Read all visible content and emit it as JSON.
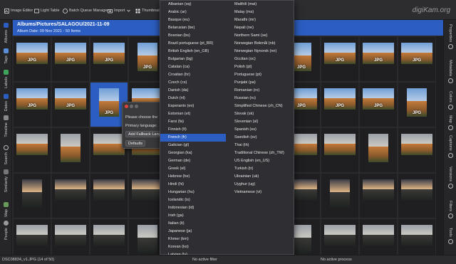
{
  "toolbar": {
    "items": [
      {
        "label": "Image Editor",
        "icon": "image-editor-icon"
      },
      {
        "label": "Light Table",
        "icon": "light-table-icon"
      },
      {
        "label": "Batch Queue Manager",
        "icon": "batch-queue-icon"
      },
      {
        "label": "Import",
        "icon": "import-icon"
      },
      {
        "label": "Thumbnails",
        "icon": "thumbnails-icon"
      }
    ],
    "brand": "digiKam.org"
  },
  "left_sidebar": {
    "tabs": [
      "Albums",
      "Tags",
      "Labels",
      "Dates",
      "Timeline",
      "Search",
      "Similarity",
      "Map",
      "People"
    ]
  },
  "right_sidebar": {
    "tabs": [
      "Properties",
      "Metadata",
      "Colors",
      "Map",
      "Captions",
      "Versions",
      "Filters",
      "Tools"
    ]
  },
  "header": {
    "title": "Albums/Pictures/SALAGOU/2021-11-09",
    "subtitle": "Album Date: 09 Nov 2021 - 50 Items"
  },
  "thumb_label": "JPG",
  "dialog": {
    "prompt": "Please choose the",
    "primary_label": "Primary language:",
    "add_button": "Add Fallback Lang",
    "defaults_button": "Defaults"
  },
  "language_menu": {
    "selected": "French (fr)",
    "column1": [
      "Albanian (sq)",
      "Arabic (ar)",
      "Basque (eu)",
      "Belarusian (be)",
      "Bosnian (bs)",
      "Brazil portuguese (pt_BR)",
      "British English (en_GB)",
      "Bulgarian (bg)",
      "Catalan (ca)",
      "Croatian (hr)",
      "Czech (cs)",
      "Danish (da)",
      "Dutch (nl)",
      "Esperanto (eo)",
      "Estonian (et)",
      "Farsi (fa)",
      "Finnish (fi)",
      "French (fr)",
      "Galician (gl)",
      "Georgian (ka)",
      "German (de)",
      "Greek (el)",
      "Hebrew (he)",
      "Hindi (hi)",
      "Hungarian (hu)",
      "Icelandic (is)",
      "Indonesian (id)",
      "Irish (ga)",
      "Italian (it)",
      "Japanese (ja)",
      "Khmer (km)",
      "Korean (ko)",
      "Latvian (lv)",
      "Lithuanian (lt)",
      "Low Saxon (nds)"
    ],
    "column2": [
      "Maithili (mai)",
      "Malay (ms)",
      "Marathi (mr)",
      "Nepali (ne)",
      "Northern Sami (se)",
      "Norwegian Bokmål (nb)",
      "Norwegian Nynorsk (nn)",
      "Occitan (oc)",
      "Polish (pl)",
      "Portuguese (pt)",
      "Punjabi (pa)",
      "Romanian (ro)",
      "Russian (ru)",
      "Simplified Chinese (zh_CN)",
      "Slovak (sk)",
      "Slovenian (sl)",
      "Spanish (es)",
      "Swedish (sv)",
      "Thai (th)",
      "Traditional Chinese (zh_TW)",
      "US English (en_US)",
      "Turkish (tr)",
      "Ukrainian (uk)",
      "Uyghur (ug)",
      "Vietnamese (vi)"
    ]
  },
  "status": {
    "file": "DSC08834_v1.JPG (14 of 50)",
    "filter": "No active filter",
    "process": "No active process"
  },
  "colors": {
    "accent": "#2c5ec2",
    "background": "#2a2a2d",
    "grid_background": "#1e1e20"
  }
}
